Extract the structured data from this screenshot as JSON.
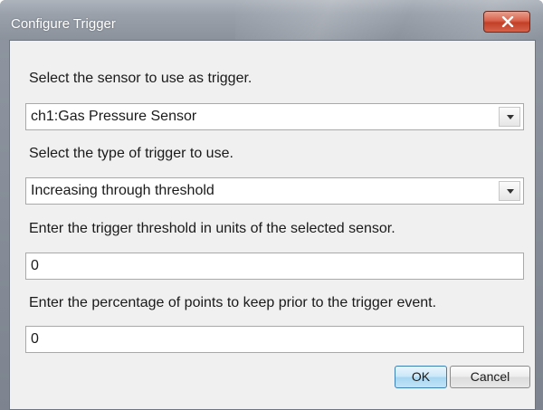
{
  "window": {
    "title": "Configure Trigger"
  },
  "sensor": {
    "label": "Select the sensor to use as trigger.",
    "selected": "ch1:Gas Pressure Sensor"
  },
  "trigger_type": {
    "label": "Select the type of trigger to use.",
    "selected": "Increasing through threshold"
  },
  "threshold": {
    "label": "Enter the trigger threshold in units of the selected sensor.",
    "value": "0"
  },
  "percentage": {
    "label": "Enter the percentage of points to keep prior to the trigger event.",
    "value": "0"
  },
  "buttons": {
    "ok_label": "OK",
    "cancel_label": "Cancel"
  },
  "icons": {
    "close": "close-icon",
    "dropdown": "chevron-down-icon"
  },
  "colors": {
    "close_button": "#c94a32",
    "ok_button_accent": "#a6d6f2"
  }
}
